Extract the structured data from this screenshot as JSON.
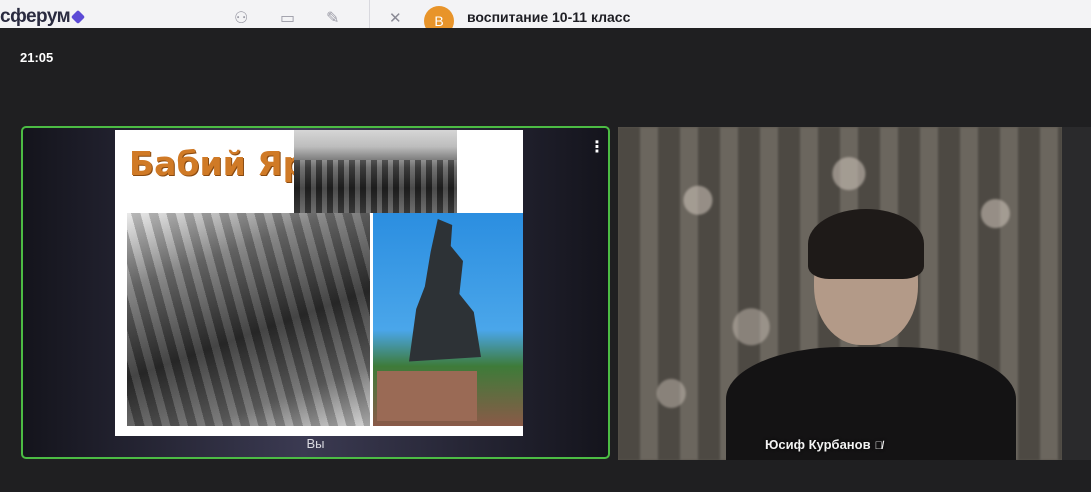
{
  "app": {
    "brand": "сферум",
    "brand_accent": "#5c4ad6"
  },
  "topbar_icons": [
    "add-user-icon",
    "archive-icon",
    "edit-icon"
  ],
  "chat": {
    "avatar_letter": "В",
    "title": "воспитание 10-11 класс",
    "avatar_color": "#e8942a"
  },
  "call": {
    "clock": "21:05",
    "self_tile": {
      "label": "Вы",
      "border_color": "#4cbc44",
      "slide_title": "Бабий Яр"
    },
    "remote_tile": {
      "name": "Юсиф Курбанов",
      "mic_icon": "mic-off-icon"
    }
  }
}
